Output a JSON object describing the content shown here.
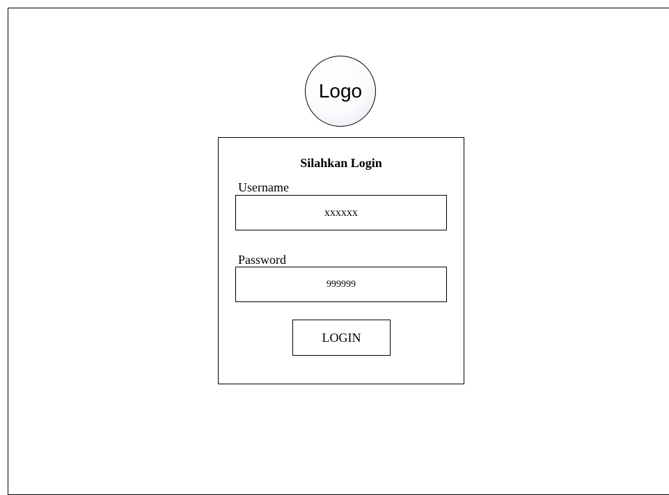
{
  "logo": {
    "label": "Logo"
  },
  "login_form": {
    "title": "Silahkan Login",
    "username_label": "Username",
    "username_value": "xxxxxx",
    "password_label": "Password",
    "password_value": "999999",
    "login_button_label": "LOGIN"
  }
}
